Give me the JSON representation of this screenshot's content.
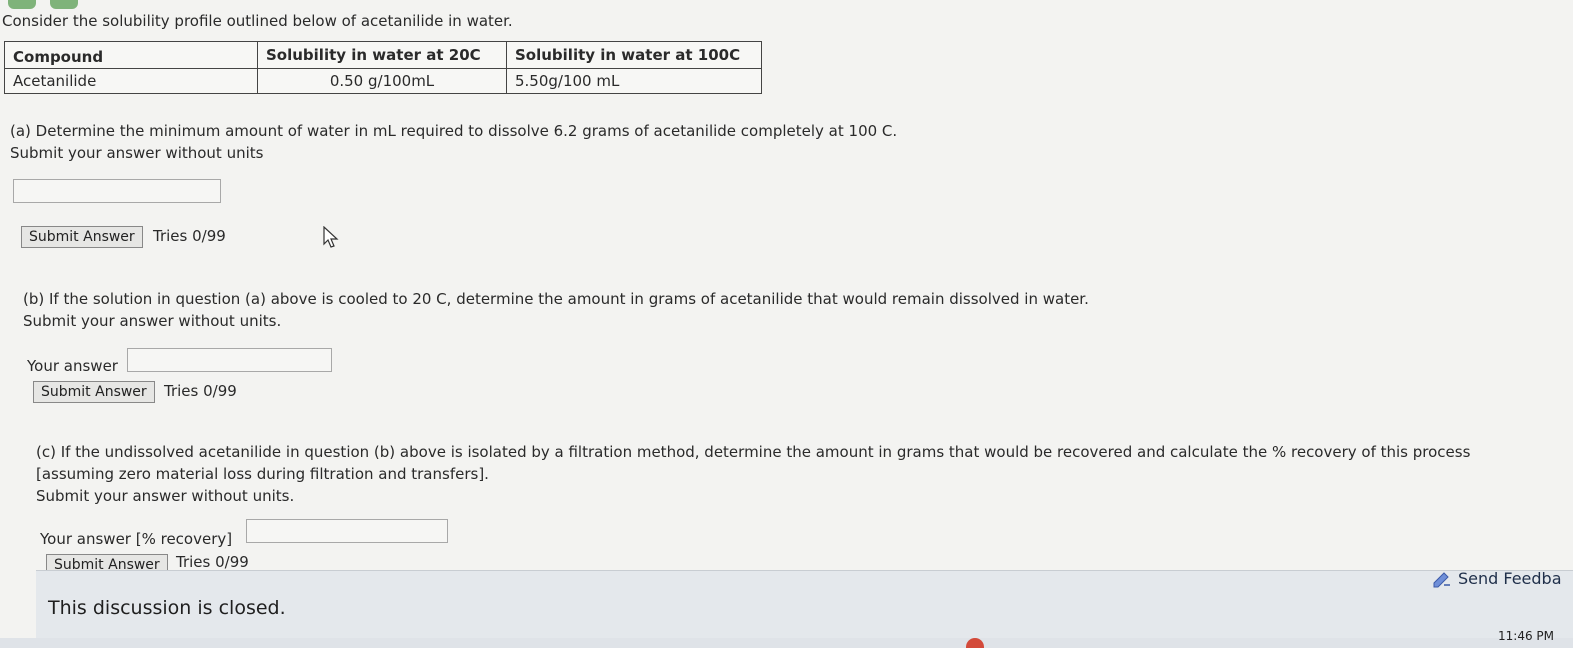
{
  "intro": "Consider the solubility profile outlined below of acetanilide in water.",
  "table": {
    "headers": [
      "Compound",
      "Solubility in water at 20C",
      "Solubility in water at 100C"
    ],
    "rows": [
      [
        "Acetanilide",
        "0.50 g/100mL",
        "5.50g/100 mL"
      ]
    ]
  },
  "part_a": {
    "line1": "(a) Determine the minimum amount of water in mL required to dissolve 6.2 grams of acetanilide completely at 100 C.",
    "line2": "Submit your answer without units",
    "input_value": "",
    "button": "Submit Answer",
    "tries": "Tries 0/99"
  },
  "part_b": {
    "line1": "(b) If the solution in question (a) above is cooled to 20 C, determine the amount in grams of acetanilide that would remain dissolved in water.",
    "line2": "Submit your answer without units.",
    "answer_label": "Your answer",
    "input_value": "",
    "button": "Submit Answer",
    "tries": "Tries 0/99"
  },
  "part_c": {
    "line1": "(c) If the undissolved acetanilide in question (b) above is isolated by a filtration method, determine the amount in grams that would be recovered and calculate the % recovery of this process",
    "line2": "[assuming zero material loss during filtration and transfers].",
    "line3": "Submit your answer without units.",
    "answer_label": "Your answer [% recovery]",
    "input_value": "",
    "button": "Submit Answer",
    "tries": "Tries 0/99"
  },
  "footer": {
    "closed": "This discussion is closed.",
    "feedback": "Send Feedba"
  },
  "taskbar": {
    "clock": "11:46 PM"
  },
  "icons": {
    "cursor": "mouse-pointer-icon",
    "feedback": "feedback-icon"
  },
  "colors": {
    "background": "#f3f3f1",
    "closed_bar": "#e4e8ec"
  }
}
